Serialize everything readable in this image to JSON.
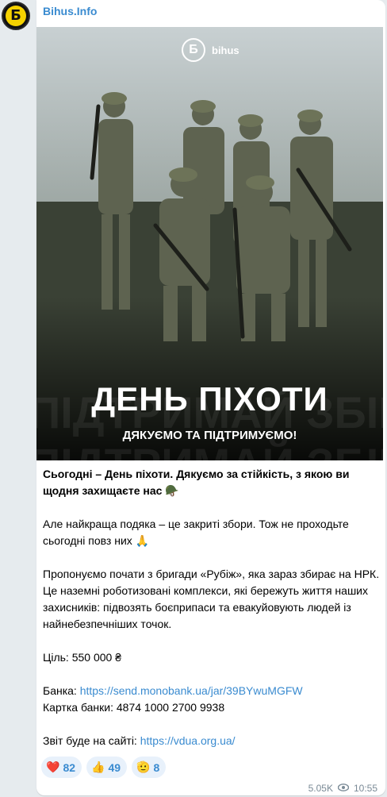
{
  "channel": {
    "name": "Bihus.Info",
    "avatar_glyph": "Б"
  },
  "image": {
    "logo_glyph": "Б",
    "logo_text": "bihus",
    "title": "ДЕНЬ ПІХОТИ",
    "subtitle": "ДЯКУЄМО ТА ПІДТРИМУЄМО!"
  },
  "post": {
    "line1": "Сьогодні – День піхоти. Дякуємо за стійкість, з якою ви щодня захищаєте нас 🪖",
    "line2": "Але найкраща подяка – це закриті збори. Тож не проходьте сьогодні повз них 🙏",
    "line3": "Пропонуємо почати з бригади «Рубіж», яка зараз збирає на НРК. Це наземні роботизовані комплекси, які бережуть життя наших захисників: підвозять боєприпаси та евакуйовують людей із найнебезпечніших точок.",
    "goal": "Ціль: 550 000 ₴",
    "bank_label": "Банка: ",
    "bank_link": "https://send.monobank.ua/jar/39BYwuMGFW",
    "card": "Картка банки: 4874 1000 2700 9938",
    "report_label": "Звіт буде на сайті: ",
    "report_link": "https://vdua.org.ua/"
  },
  "reactions": [
    {
      "emoji": "❤️",
      "count": "82",
      "icon": "heart-icon"
    },
    {
      "emoji": "👍",
      "count": "49",
      "icon": "thumbs-up-icon"
    },
    {
      "emoji": "🫡",
      "count": "8",
      "icon": "salute-icon"
    }
  ],
  "meta": {
    "views": "5.05K",
    "time": "10:55"
  },
  "colors": {
    "link": "#3a8bd0",
    "accent_yellow": "#f5d200",
    "bg": "#e6ebee"
  }
}
